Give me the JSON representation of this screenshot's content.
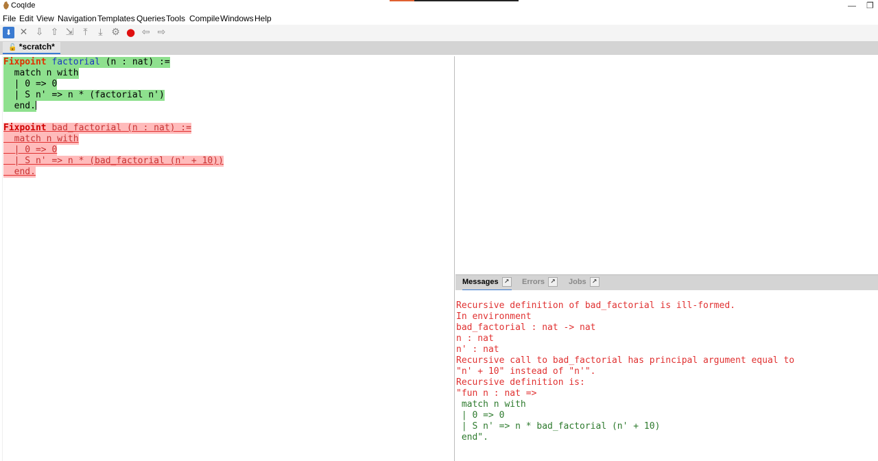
{
  "window": {
    "title": "CoqIde",
    "min_glyph": "—",
    "restore_glyph": "❐"
  },
  "menu": [
    "File",
    "Edit",
    "View",
    "Navigation",
    "Templates",
    "Queries",
    "Tools",
    "Compile",
    "Windows",
    "Help"
  ],
  "toolbar": {
    "icons": [
      "save-icon",
      "close-icon",
      "forward-one-icon",
      "backward-one-icon",
      "go-to-cursor-icon",
      "restart-icon",
      "go-to-end-icon",
      "interrupt-icon",
      "record-icon",
      "previous-occurrence-icon",
      "next-occurrence-icon"
    ]
  },
  "tab": {
    "lock_glyph": "🔓",
    "label": "*scratch*"
  },
  "editor": {
    "ok": {
      "l1_kw": "Fixpoint",
      "l1_fn": "factorial",
      "l1_rest": " (n : nat) :=",
      "l2": "  match n with",
      "l3": "  | 0 => 0",
      "l4": "  | S n' => n * (factorial n')",
      "l5": "  end."
    },
    "bad": {
      "l1_kw": "Fixpoint",
      "l1_fn": " bad_factorial",
      "l1_rest": " (n : nat) :=",
      "l2": "  match n with",
      "l3": "  | 0 => 0",
      "l4": "  | S n' => n * (bad_factorial (n' + 10))",
      "l5": "  end."
    }
  },
  "message_tabs": [
    {
      "label": "Messages",
      "active": true
    },
    {
      "label": "Errors",
      "active": false
    },
    {
      "label": "Jobs",
      "active": false
    }
  ],
  "pin_glyph": "↗",
  "messages": [
    "Recursive definition of bad_factorial is ill-formed.",
    "In environment",
    "bad_factorial : nat -> nat",
    "n : nat",
    "n' : nat",
    "Recursive call to bad_factorial has principal argument equal to",
    "\"n' + 10\" instead of \"n'\".",
    "Recursive definition is:",
    "\"fun n : nat =>",
    " match n with",
    " | 0 => 0",
    " | S n' => n * bad_factorial (n' + 10)",
    " end\"."
  ],
  "colors": {
    "accent": "#3b7bd1",
    "ok_bg": "#8ee08e",
    "error_bg": "#ffbbbb",
    "error_text": "#e03030"
  }
}
